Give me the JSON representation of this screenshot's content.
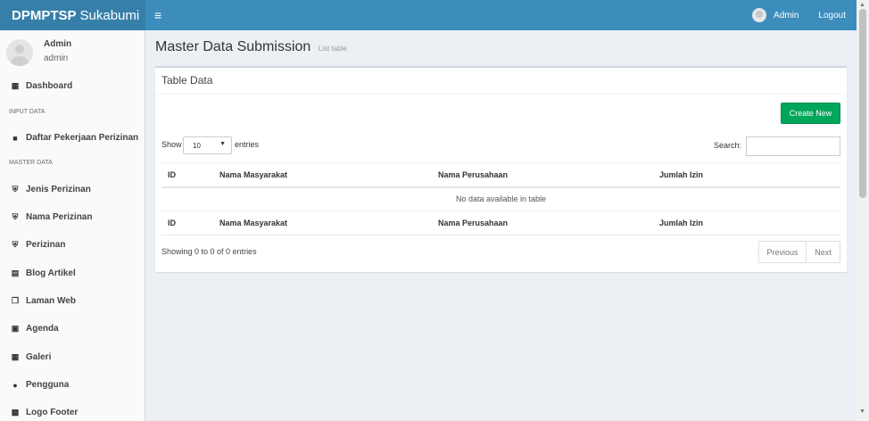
{
  "header": {
    "brand_bold": "DPMPTSP",
    "brand_rest": "Sukabumi",
    "user": "Admin",
    "logout": "Logout"
  },
  "sidebar": {
    "user_name": "Admin",
    "user_role": "admin",
    "sections": {
      "input": "INPUT DATA",
      "master": "MASTER DATA"
    },
    "items": [
      {
        "label": "Dashboard",
        "icon": "grid-icon"
      },
      {
        "label": "Daftar Pekerjaan Perizinan",
        "icon": "briefcase-icon"
      },
      {
        "label": "Jenis Perizinan",
        "icon": "shield-icon"
      },
      {
        "label": "Nama Perizinan",
        "icon": "shield-icon"
      },
      {
        "label": "Perizinan",
        "icon": "shield-icon"
      },
      {
        "label": "Blog Artikel",
        "icon": "newspaper-icon"
      },
      {
        "label": "Laman Web",
        "icon": "copy-icon"
      },
      {
        "label": "Agenda",
        "icon": "calendar-icon"
      },
      {
        "label": "Galeri",
        "icon": "table-icon"
      },
      {
        "label": "Pengguna",
        "icon": "users-icon"
      },
      {
        "label": "Logo Footer",
        "icon": "image-icon"
      }
    ]
  },
  "page": {
    "title": "Master Data Submission",
    "subtitle": "List table"
  },
  "box": {
    "title": "Table Data",
    "create_label": "Create New",
    "show_label": "Show",
    "page_length": "10",
    "entries_label": "entries",
    "search_label": "Search:",
    "columns": [
      "ID",
      "Nama Masyarakat",
      "Nama Perusahaan",
      "Jumlah Izin",
      ""
    ],
    "empty_message": "No data available in table",
    "info": "Showing 0 to 0 of 0 entries",
    "prev_label": "Previous",
    "next_label": "Next"
  },
  "colors": {
    "header": "#3c8dbc",
    "logo_bg": "#367fa9",
    "create_button": "#00a65a"
  }
}
